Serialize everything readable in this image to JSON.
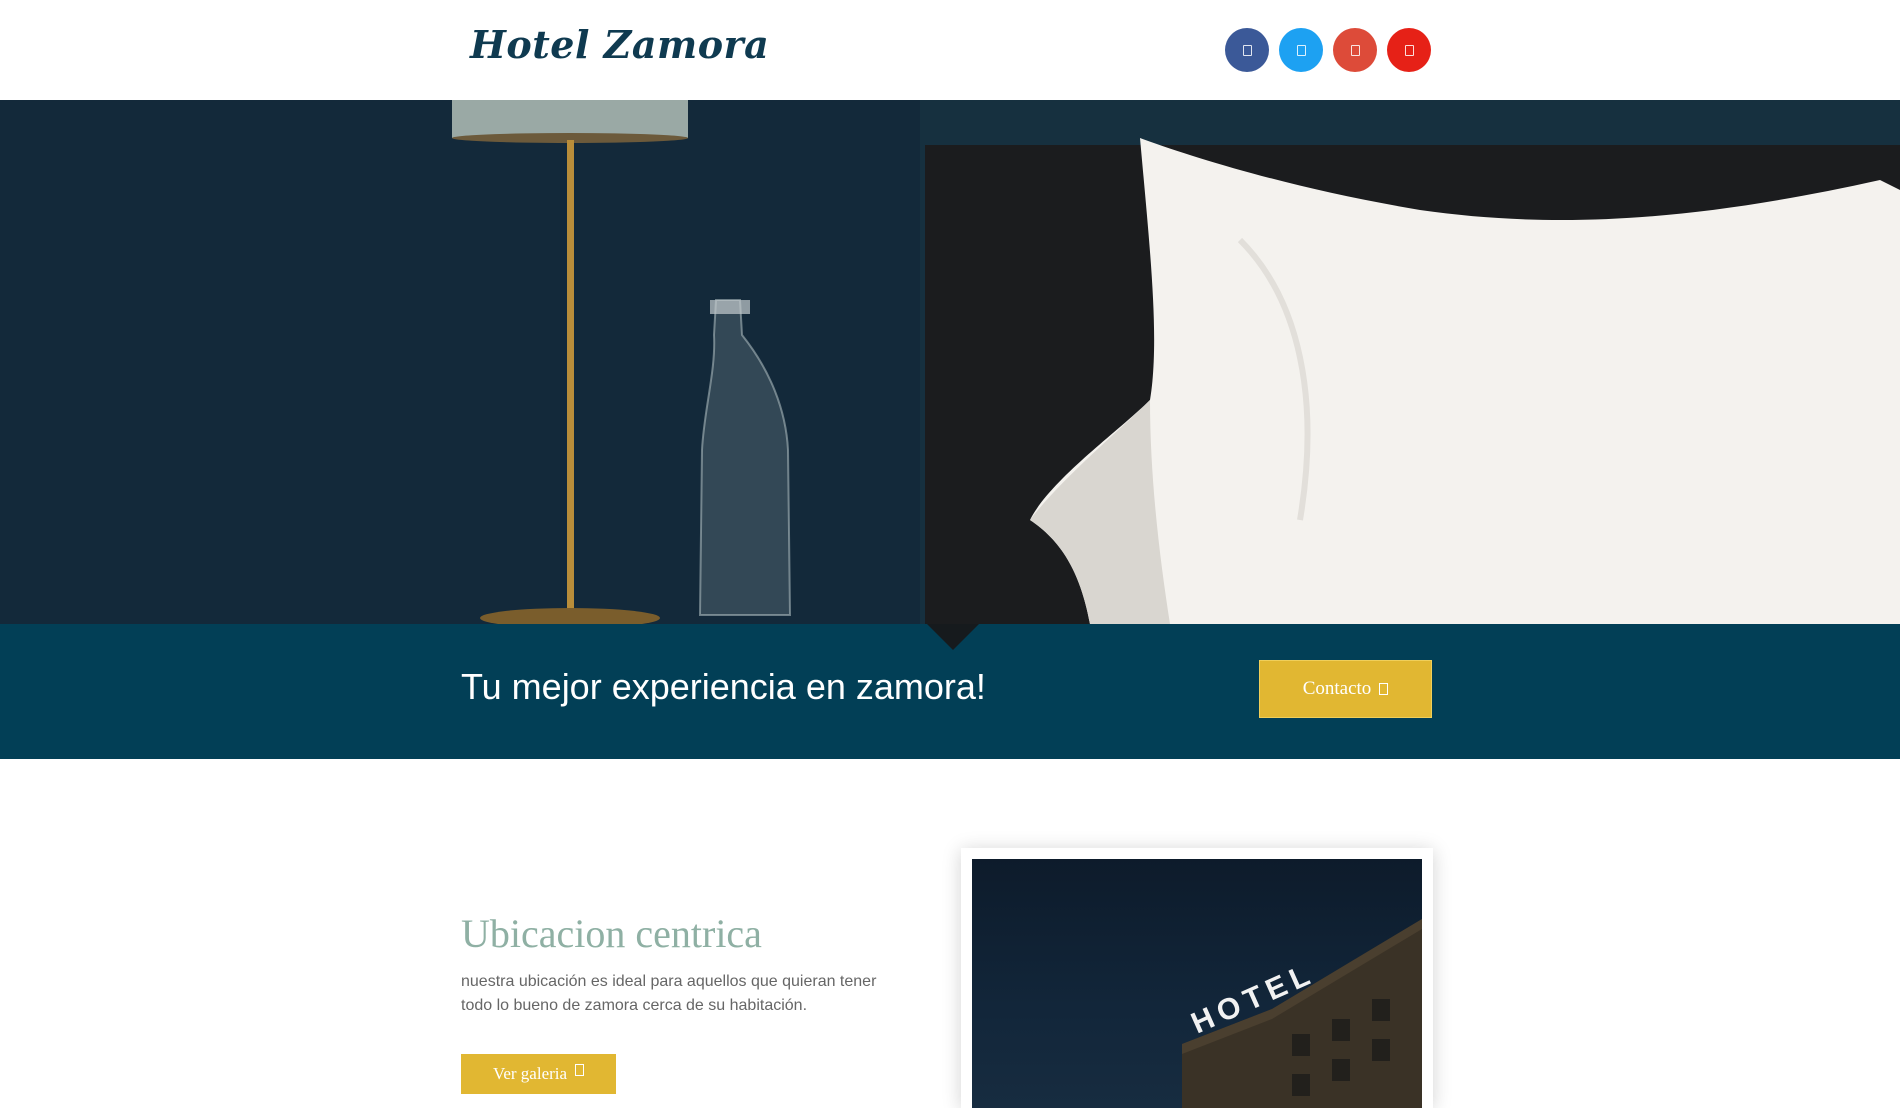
{
  "header": {
    "logo": "Hotel Zamora",
    "social": [
      {
        "icon": "facebook-icon",
        "color": "#3b5998"
      },
      {
        "icon": "twitter-icon",
        "color": "#1da1f2"
      },
      {
        "icon": "google-plus-icon",
        "color": "#dd4b39"
      },
      {
        "icon": "youtube-icon",
        "color": "#e62117"
      }
    ]
  },
  "banner": {
    "tagline": "Tu mejor experiencia en zamora!",
    "contact_label": "Contacto"
  },
  "location": {
    "title": "Ubicacion centrica",
    "text": "nuestra ubicación es ideal para aquellos que quieran tener todo lo bueno de zamora cerca de su habitación.",
    "gallery_label": "Ver galeria"
  },
  "photo": {
    "sign_text": "HOTEL"
  },
  "colors": {
    "brand_dark": "#023f56",
    "accent_gold": "#e1b732",
    "heading_green": "#8fb0a4"
  }
}
